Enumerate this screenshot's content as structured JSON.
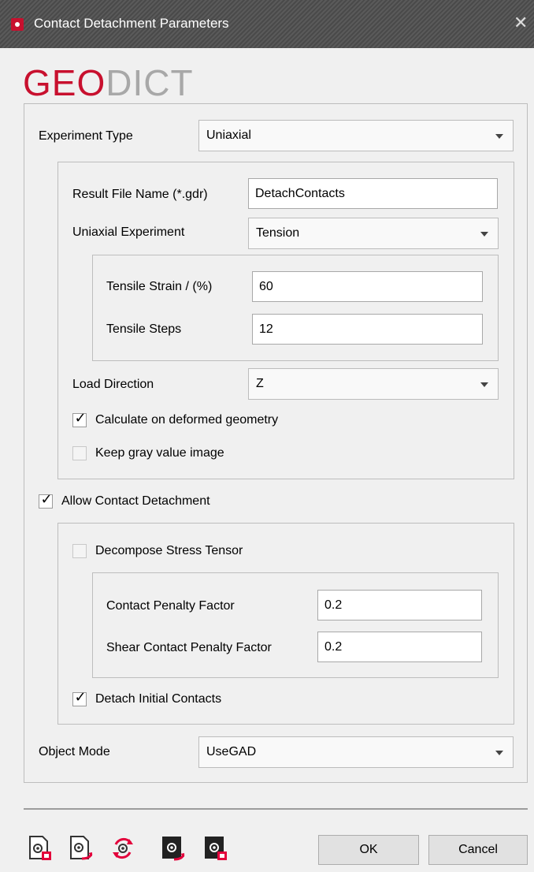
{
  "window": {
    "title": "Contact Detachment Parameters",
    "close_glyph": "✕"
  },
  "logo": {
    "part1": "GEO",
    "part2": "DICT"
  },
  "colors": {
    "accent": "#c8102e",
    "logo_gray": "#a8a8a8",
    "titlebar": "#4f4f4f"
  },
  "form": {
    "experiment_type": {
      "label": "Experiment Type",
      "value": "Uniaxial"
    },
    "result_file": {
      "label": "Result File Name (*.gdr)",
      "value": "DetachContacts"
    },
    "uniaxial_experiment": {
      "label": "Uniaxial Experiment",
      "value": "Tension"
    },
    "tensile_strain": {
      "label": "Tensile Strain / (%)",
      "value": "60"
    },
    "tensile_steps": {
      "label": "Tensile Steps",
      "value": "12"
    },
    "load_direction": {
      "label": "Load Direction",
      "value": "Z"
    },
    "calc_deformed": {
      "label": "Calculate on deformed geometry",
      "checked": true
    },
    "keep_gray": {
      "label": "Keep gray value image",
      "checked": false
    },
    "allow_detachment": {
      "label": "Allow Contact Detachment",
      "checked": true
    },
    "decompose_stress": {
      "label": "Decompose Stress Tensor",
      "checked": false
    },
    "contact_penalty": {
      "label": "Contact Penalty Factor",
      "value": "0.2"
    },
    "shear_penalty": {
      "label": "Shear Contact Penalty Factor",
      "value": "0.2"
    },
    "detach_initial": {
      "label": "Detach Initial Contacts",
      "checked": true
    },
    "object_mode": {
      "label": "Object Mode",
      "value": "UseGAD"
    }
  },
  "toolbar": {
    "icons": [
      "load-settings-icon",
      "save-settings-icon",
      "reset-settings-icon",
      "load-macro-icon",
      "save-macro-icon"
    ]
  },
  "buttons": {
    "ok": "OK",
    "cancel": "Cancel"
  },
  "check_glyph": "✓"
}
